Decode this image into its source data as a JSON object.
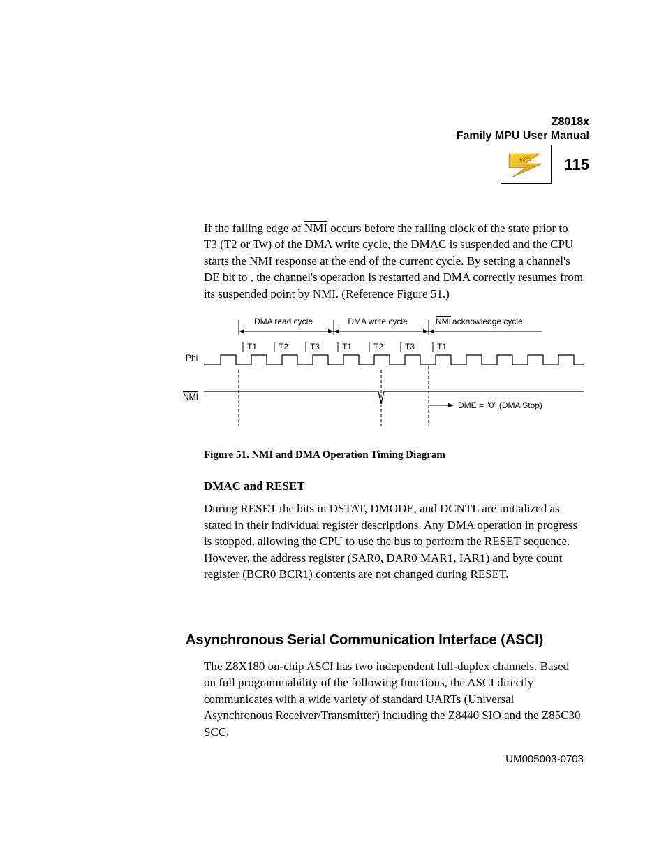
{
  "header": {
    "product": "Z8018x",
    "manual": "Family MPU User Manual",
    "page_number": "115"
  },
  "body": {
    "p1a": "If the falling edge of ",
    "p1_nmi1": "NMI",
    "p1b": " occurs before the falling clock of the state prior to T3 (T2 or Tw) of the DMA write cycle, the DMAC is suspended and the CPU starts the ",
    "p1_nmi2": "NMI",
    "p1c": " response at the end of the current cycle. By setting a channel's DE bit to   , the channel's operation is restarted and DMA correctly resumes from its suspended point by ",
    "p1_nmi3": "NMI",
    "p1d": ". (Reference Figure 51.)",
    "fig_caption_a": "Figure 51.   ",
    "fig_caption_nmi": "NMI",
    "fig_caption_b": " and DMA Operation Timing Diagram",
    "sub1": "DMAC and RESET",
    "p2": "During RESET the bits in DSTAT, DMODE, and DCNTL are initialized as stated in their individual register descriptions. Any DMA operation in progress is stopped, allowing the CPU to use the bus to perform the RESET sequence. However, the address register (SAR0, DAR0 MAR1, IAR1) and byte count register (BCR0 BCR1) contents are not changed during RESET.",
    "section": "Asynchronous Serial Communication Interface (ASCI)",
    "p3": "The Z8X180 on-chip ASCI has two independent full-duplex channels. Based on full programmability of the following functions, the ASCI directly communicates with a wide variety of standard UARTs (Universal Asynchronous Receiver/Transmitter) including the Z8440 SIO and the Z85C30 SCC."
  },
  "diagram": {
    "phi": "Phi",
    "nmi": "NMI",
    "dma_read": "DMA read cycle",
    "dma_write": "DMA write cycle",
    "nmi_ack": "NMI",
    "nmi_ack_suffix": " acknowledge cycle",
    "t1": "T1",
    "t2": "T2",
    "t3": "T3",
    "dme": "DME = \"0\" (DMA Stop)"
  },
  "footer": {
    "docid": "UM005003-0703"
  }
}
